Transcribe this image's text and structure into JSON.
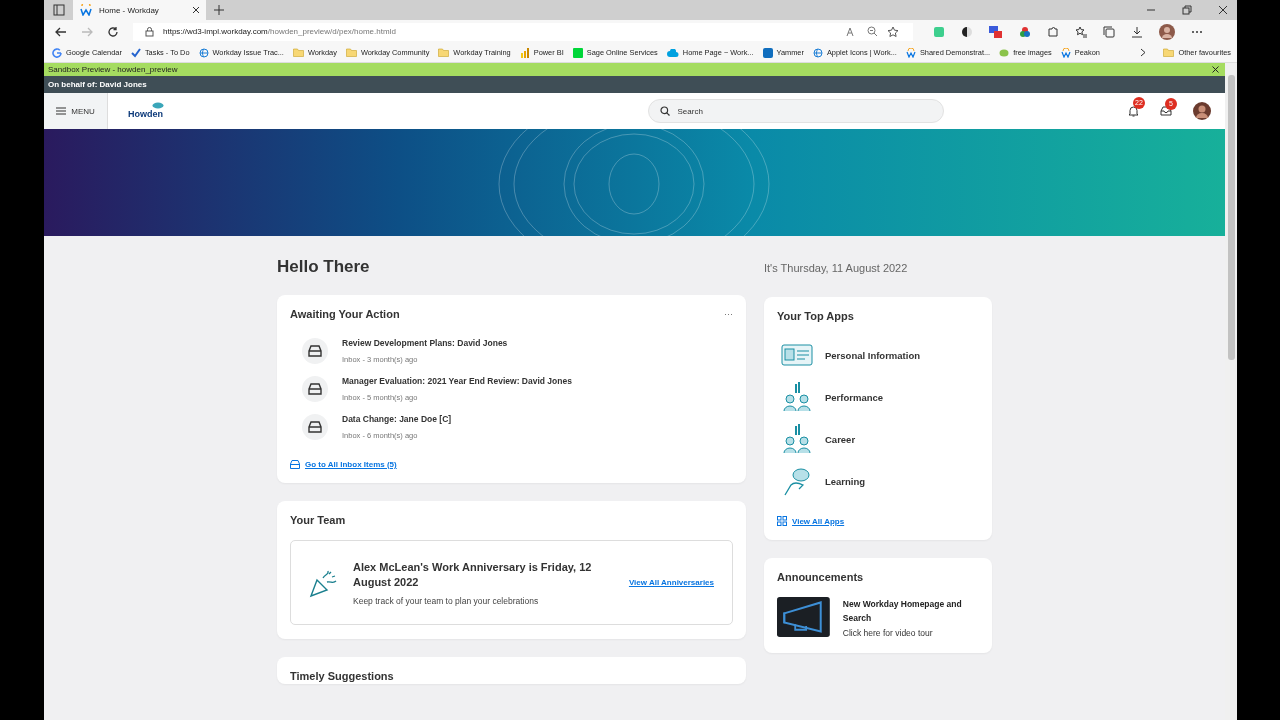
{
  "browser": {
    "tab_title": "Home - Workday",
    "url_host": "https://wd3-impl.workday.com",
    "url_path": "/howden_preview/d/pex/home.htmld",
    "bookmarks": [
      {
        "label": "Google Calendar",
        "kind": "google"
      },
      {
        "label": "Tasks - To Do",
        "kind": "check"
      },
      {
        "label": "Workday Issue Trac...",
        "kind": "globe"
      },
      {
        "label": "Workday",
        "kind": "folder"
      },
      {
        "label": "Workday Community",
        "kind": "folder"
      },
      {
        "label": "Workday Training",
        "kind": "folder"
      },
      {
        "label": "Power BI",
        "kind": "chart"
      },
      {
        "label": "Sage Online Services",
        "kind": "sage"
      },
      {
        "label": "Home Page ~ Work...",
        "kind": "cloud"
      },
      {
        "label": "Yammer",
        "kind": "yammer"
      },
      {
        "label": "Applet Icons | Work...",
        "kind": "globe"
      },
      {
        "label": "Shared Demonstrat...",
        "kind": "w"
      },
      {
        "label": "free images",
        "kind": "leaf"
      },
      {
        "label": "Peakon",
        "kind": "w"
      }
    ],
    "other_favourites": "Other favourites"
  },
  "sandbox_bar": {
    "text": "Sandbox Preview - howden_preview"
  },
  "behalf_bar": {
    "text": "On behalf of: David Jones"
  },
  "header": {
    "menu": "MENU",
    "logo": "Howden",
    "search": {
      "placeholder": "Search"
    },
    "notifications": "22",
    "inbox": "5"
  },
  "greeting": "Hello There",
  "date": "It's Thursday, 11 August 2022",
  "awaiting": {
    "title": "Awaiting Your Action",
    "more": "···",
    "items": [
      {
        "title": "Review Development Plans: David Jones",
        "meta": "Inbox - 3 month(s) ago"
      },
      {
        "title": "Manager Evaluation: 2021 Year End Review: David Jones",
        "meta": "Inbox - 5 month(s) ago"
      },
      {
        "title": "Data Change: Jane Doe [C]",
        "meta": "Inbox - 6 month(s) ago"
      }
    ],
    "link": "Go to All Inbox Items (5)"
  },
  "team": {
    "title": "Your Team",
    "headline": "Alex McLean's Work Anniversary is Friday, 12 August 2022",
    "sub": "Keep track of your team to plan your celebrations",
    "link": "View All Anniversaries"
  },
  "suggestions": {
    "title": "Timely Suggestions"
  },
  "top_apps": {
    "title": "Your Top Apps",
    "apps": [
      {
        "label": "Personal Information",
        "kind": "id"
      },
      {
        "label": "Performance",
        "kind": "people"
      },
      {
        "label": "Career",
        "kind": "people"
      },
      {
        "label": "Learning",
        "kind": "learn"
      }
    ],
    "link": "View All Apps"
  },
  "announcements": {
    "title": "Announcements",
    "item": {
      "title": "New Workday Homepage and Search",
      "sub": "Click here for video tour"
    }
  }
}
